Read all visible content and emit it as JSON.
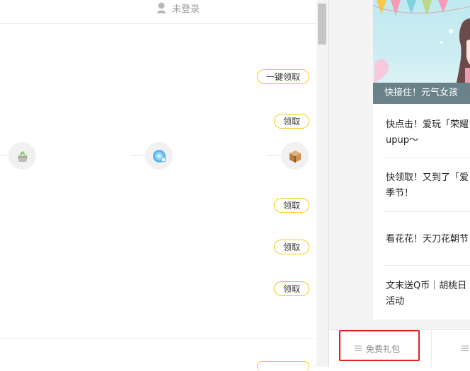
{
  "header": {
    "login_status": "未登录"
  },
  "rewards": {
    "claim_all_label": "一键领取",
    "claim_label": "领取"
  },
  "steps": [
    {
      "icon": "plant-pot-icon"
    },
    {
      "icon": "snail-shell-icon"
    },
    {
      "icon": "treasure-box-icon"
    }
  ],
  "news": {
    "banner_caption": "快接住！元气女孩",
    "items": [
      {
        "line1": "快点击！爱玩「荣耀",
        "line2": "upup～"
      },
      {
        "line1": "快领取！又到了「爱",
        "line2": "季节！"
      },
      {
        "line1": "看花花！天刀花朝节",
        "line2": ""
      },
      {
        "line1": "文末送Q币｜胡桃日",
        "line2": "活动"
      }
    ]
  },
  "tabs": {
    "gift_tab_label": "免费礼包"
  },
  "colors": {
    "accent_yellow": "#f2c811",
    "highlight_red": "#e0231b"
  }
}
